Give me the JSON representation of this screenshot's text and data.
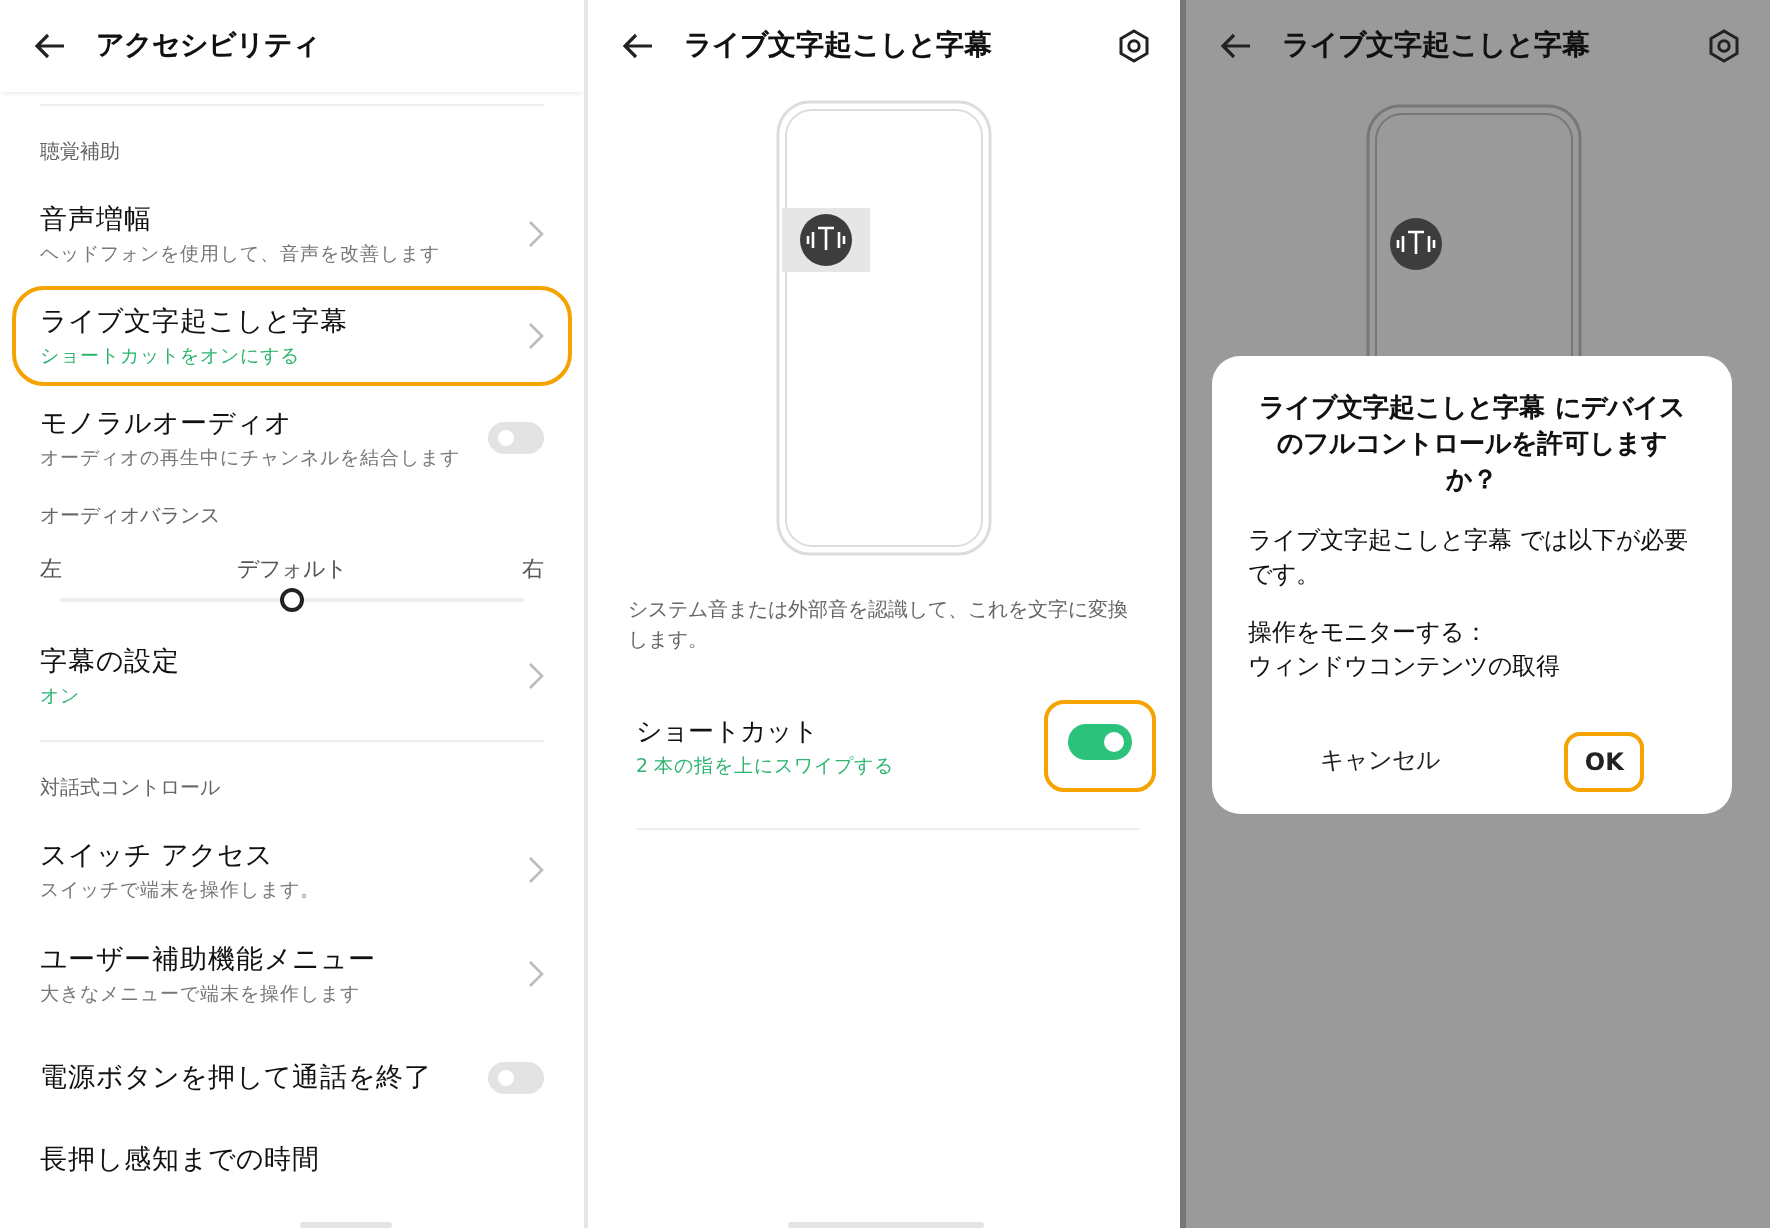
{
  "accessibility": {
    "title": "アクセシビリティ",
    "items": [
      {
        "kind": "section",
        "label": "聴覚補助",
        "divider": true
      },
      {
        "kind": "nav",
        "title": "音声増幅",
        "subtitle": "ヘッドフォンを使用して、音声を改善します",
        "subtitle_accent": false,
        "highlighted": false
      },
      {
        "kind": "nav",
        "title": "ライブ文字起こしと字幕",
        "subtitle": "ショートカットをオンにする",
        "subtitle_accent": true,
        "highlighted": true
      },
      {
        "kind": "toggle",
        "title": "モノラルオーディオ",
        "subtitle": "オーディオの再生中にチャンネルを結合します",
        "on": false
      },
      {
        "kind": "section",
        "label": "オーディオバランス",
        "divider": false
      },
      {
        "kind": "balance",
        "left": "左",
        "center": "デフォルト",
        "right": "右",
        "level": 0.5
      },
      {
        "kind": "nav",
        "title": "字幕の設定",
        "subtitle": "オン",
        "subtitle_accent": true,
        "highlighted": false
      },
      {
        "kind": "section",
        "label": "対話式コントロール",
        "divider": true
      },
      {
        "kind": "nav",
        "title": "スイッチ アクセス",
        "subtitle": "スイッチで端末を操作します。",
        "subtitle_accent": false,
        "highlighted": false
      },
      {
        "kind": "nav",
        "title": "ユーザー補助機能メニュー",
        "subtitle": "大きなメニューで端末を操作します",
        "subtitle_accent": false,
        "highlighted": false
      },
      {
        "kind": "toggle",
        "title": "電源ボタンを押して通話を終了",
        "on": false
      },
      {
        "kind": "cut",
        "title": "長押し感知までの時間"
      }
    ]
  },
  "live_caption": {
    "title": "ライブ文字起こしと字幕",
    "description": "システム音または外部音を認識して、これを文字に変換します。",
    "shortcut": {
      "title": "ショートカット",
      "subtitle": "2 本の指を上にスワイプする",
      "on": true,
      "highlighted": true
    }
  },
  "permission": {
    "title": "ライブ文字起こしと字幕",
    "dialog": {
      "title": "ライブ文字起こしと字幕 にデバイスのフルコントロールを許可しますか？",
      "body": [
        [
          "ライブ文字起こしと字幕 では以下が必要です。"
        ],
        [
          "操作をモニターする：",
          "ウィンドウコンテンツの取得"
        ]
      ],
      "buttons": [
        {
          "label": "キャンセル",
          "highlighted": false
        },
        {
          "label": "OK",
          "highlighted": true
        }
      ]
    }
  }
}
